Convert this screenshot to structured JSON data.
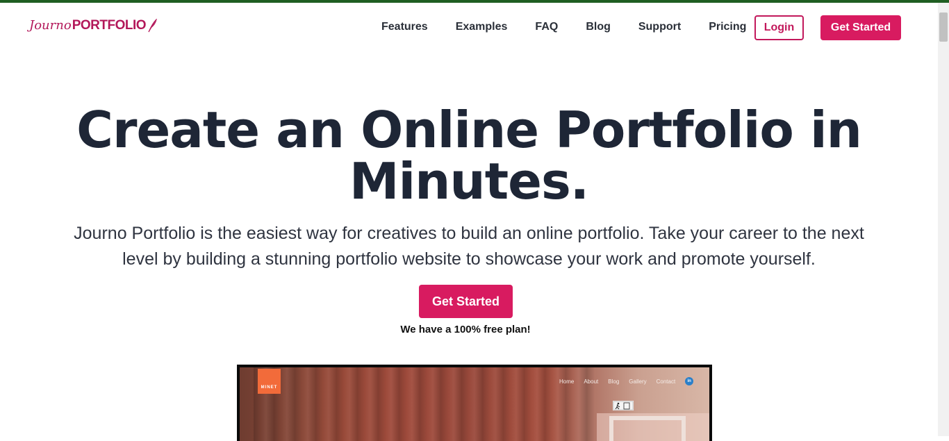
{
  "brand": {
    "logo_part1": "Journo",
    "logo_part2": "PORTFOLIO",
    "accent": "#d81b60",
    "top_accent": "#1f5e22"
  },
  "nav": {
    "links": [
      "Features",
      "Examples",
      "FAQ",
      "Blog",
      "Support",
      "Pricing"
    ],
    "login": "Login",
    "get_started": "Get Started"
  },
  "hero": {
    "title_line1": "Create an Online Portfolio in",
    "title_line2": "Minutes.",
    "subtitle_line1": "Journo Portfolio is the easiest way for creatives to build an online portfolio. Take your career to the next",
    "subtitle_line2": "level by building a stunning portfolio website to showcase your work and promote yourself.",
    "cta": "Get Started",
    "note": "We have a 100% free plan!"
  },
  "preview": {
    "logo_text": "MINET",
    "nav": [
      "Home",
      "About",
      "Blog",
      "Gallery",
      "Contact"
    ],
    "social": "in"
  }
}
